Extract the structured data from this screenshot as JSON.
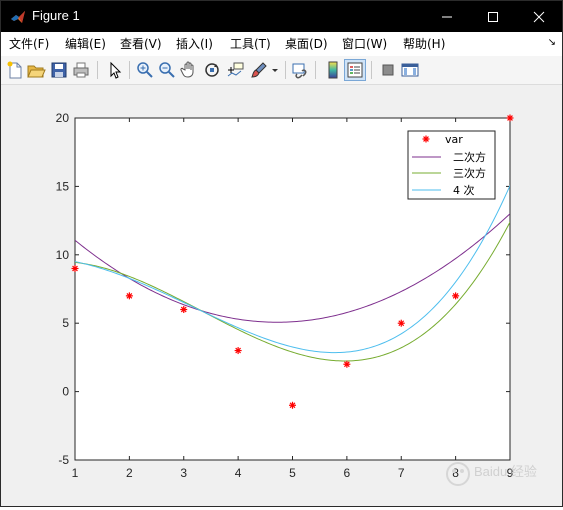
{
  "window": {
    "title": "Figure 1",
    "colors": {
      "titlebar": "#000000",
      "figure_bg": "#f0f0f0",
      "axes_bg": "#ffffff"
    }
  },
  "menu": {
    "items": [
      "文件(F)",
      "编辑(E)",
      "查看(V)",
      "插入(I)",
      "工具(T)",
      "桌面(D)",
      "窗口(W)",
      "帮助(H)"
    ],
    "overflow": "↘"
  },
  "toolbar": {
    "icons": [
      "new-figure-icon",
      "open-file-icon",
      "save-icon",
      "print-icon",
      "pointer-icon",
      "zoom-in-icon",
      "zoom-out-icon",
      "pan-icon",
      "rotate-3d-icon",
      "data-cursor-icon",
      "brush-icon",
      "link-plot-icon",
      "colorbar-icon",
      "legend-icon",
      "hide-plot-tools-icon",
      "show-plot-tools-icon"
    ]
  },
  "chart_data": {
    "type": "line",
    "xlim": [
      1,
      9
    ],
    "ylim": [
      -5,
      20
    ],
    "xticks": [
      "1",
      "2",
      "3",
      "4",
      "5",
      "6",
      "7",
      "8",
      "9"
    ],
    "yticks": [
      "-5",
      "0",
      "5",
      "10",
      "15",
      "20"
    ],
    "grid": false,
    "legend_position": "top-right",
    "points": {
      "name": "var",
      "color": "#ff0000",
      "x": [
        1,
        2,
        3,
        4,
        5,
        6,
        7,
        8,
        9
      ],
      "y": [
        9,
        7,
        6,
        3,
        -1,
        2,
        5,
        7,
        20
      ]
    },
    "series": [
      {
        "name": "二次方",
        "color": "#7e2f8e",
        "coeffs": [
          14.7143,
          -4.0866,
          0.4329
        ]
      },
      {
        "name": "三次方",
        "color": "#77ac30",
        "coeffs": [
          9.0476,
          1.3074,
          -1.013,
          0.101
        ]
      },
      {
        "name": "4 次",
        "color": "#4dbeee",
        "coeffs": [
          9.8095,
          0.2611,
          -0.6167,
          0.0455,
          0.003
        ]
      }
    ]
  },
  "watermark": {
    "text": "Baidu 经验"
  }
}
